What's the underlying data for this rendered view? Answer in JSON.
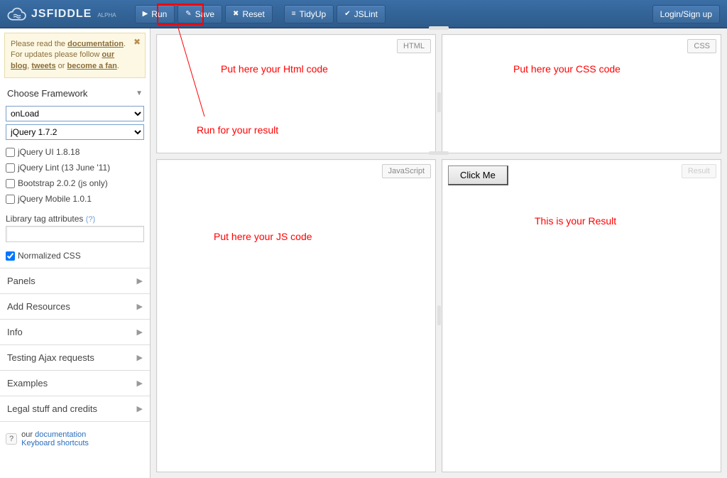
{
  "header": {
    "brand": "JSFIDDLE",
    "brand_sub": "ALPHA",
    "toolbar": {
      "run": "Run",
      "save": "Save",
      "reset": "Reset",
      "tidy": "TidyUp",
      "jslint": "JSLint"
    },
    "login": "Login/Sign up"
  },
  "sidebar": {
    "notice": {
      "line1_pre": "Please read the ",
      "doc_link": "documentation",
      "line1_post": ".",
      "line2_pre": "For updates please follow ",
      "blog_link": "our blog",
      "line2_mid": ", ",
      "tweets_link": "tweets",
      "line2_mid2": " or ",
      "fan_link": "become a fan",
      "line2_post": "."
    },
    "framework_title": "Choose Framework",
    "load_select": "onLoad",
    "framework_select": "jQuery 1.7.2",
    "checks": [
      {
        "label": "jQuery UI 1.8.18",
        "checked": false
      },
      {
        "label": "jQuery Lint (13 June '11)",
        "checked": false
      },
      {
        "label": "Bootstrap 2.0.2 (js only)",
        "checked": false
      },
      {
        "label": "jQuery Mobile 1.0.1",
        "checked": false
      }
    ],
    "lib_attr_label": "Library tag attributes",
    "lib_attr_help": "(?)",
    "normalized_css": {
      "label": "Normalized CSS",
      "checked": true
    },
    "accordion": [
      "Panels",
      "Add Resources",
      "Info",
      "Testing Ajax requests",
      "Examples",
      "Legal stuff and credits"
    ],
    "footer": {
      "pre": "our ",
      "doc": "documentation",
      "kb": "Keyboard shortcuts"
    }
  },
  "panels": {
    "html_label": "HTML",
    "css_label": "CSS",
    "js_label": "JavaScript",
    "result_label": "Result",
    "result_button": "Click Me"
  },
  "annotations": {
    "html": "Put here your Html code",
    "css": "Put here your CSS code",
    "js": "Put here your JS code",
    "result": "This is your Result",
    "run": "Run for your result"
  }
}
